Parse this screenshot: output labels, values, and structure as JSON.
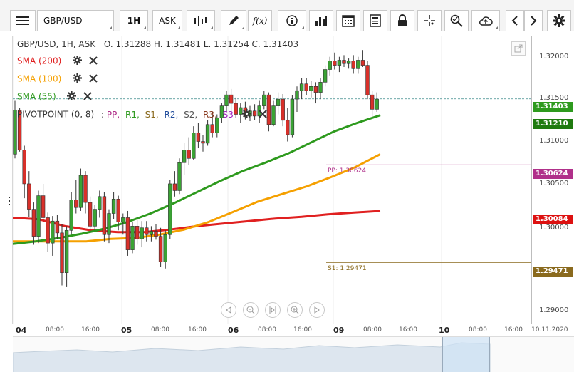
{
  "toolbar": {
    "symbol": "GBP/USD",
    "timeframe": "1H",
    "price_type": "ASK",
    "fx_label": "f(x)"
  },
  "ohlc": {
    "title": "GBP/USD, 1H, ASK",
    "values": "O. 1.31288 H. 1.31481 L. 1.31254 C. 1.31403"
  },
  "indicators": [
    {
      "label": "SMA (200)",
      "color": "#e02020"
    },
    {
      "label": "SMA (100)",
      "color": "#f5a000"
    },
    {
      "label": "SMA (55)",
      "color": "#2e9a1e"
    }
  ],
  "pivot": {
    "label": "PIVOTPOINT (0, 8)",
    "sep": ":",
    "items": [
      {
        "label": "PP,",
        "color": "#b0308a"
      },
      {
        "label": "R1,",
        "color": "#2e9a1e"
      },
      {
        "label": "S1,",
        "color": "#8a6a1e"
      },
      {
        "label": "R2,",
        "color": "#1e4a9a"
      },
      {
        "label": "S2,",
        "color": "#555555"
      },
      {
        "label": "R3,",
        "color": "#8a3a1e"
      },
      {
        "label": "S3",
        "color": "#a020c0"
      }
    ],
    "pp_text": "PP: 1.30624",
    "s1_text": "S1: 1.29471"
  },
  "price_axis": {
    "ticks": [
      "1.32000",
      "1.31500",
      "1.31000",
      "1.30500",
      "1.30000",
      "1.29000"
    ],
    "current": "1.31403",
    "sma55": "1.31210",
    "pp": "1.30624",
    "sma200": "1.30084",
    "s1": "1.29471",
    "colors": {
      "current": "#2e9a1e",
      "sma55": "#1f7a10",
      "pp": "#b0308a",
      "sma200": "#dd1111",
      "s1": "#8a6a1e"
    }
  },
  "time_axis": {
    "labels": [
      {
        "text": "04",
        "bold": true
      },
      {
        "text": "08:00",
        "bold": false
      },
      {
        "text": "16:00",
        "bold": false
      },
      {
        "text": "05",
        "bold": true
      },
      {
        "text": "08:00",
        "bold": false
      },
      {
        "text": "16:00",
        "bold": false
      },
      {
        "text": "06",
        "bold": true
      },
      {
        "text": "08:00",
        "bold": false
      },
      {
        "text": "16:00",
        "bold": false
      },
      {
        "text": "09",
        "bold": true
      },
      {
        "text": "08:00",
        "bold": false
      },
      {
        "text": "16:00",
        "bold": false
      },
      {
        "text": "10",
        "bold": true
      },
      {
        "text": "08:00",
        "bold": false
      },
      {
        "text": "16:00",
        "bold": false
      },
      {
        "text": "10.11.2020",
        "bold": false
      }
    ]
  },
  "candles": [
    {
      "o": 1.3075,
      "h": 1.3138,
      "l": 1.307,
      "c": 1.3127
    },
    {
      "o": 1.3127,
      "h": 1.313,
      "l": 1.3078,
      "c": 1.308
    },
    {
      "o": 1.308,
      "h": 1.3085,
      "l": 1.3023,
      "c": 1.304
    },
    {
      "o": 1.304,
      "h": 1.3055,
      "l": 1.3001,
      "c": 1.301
    },
    {
      "o": 1.301,
      "h": 1.3018,
      "l": 1.2968,
      "c": 1.2978
    },
    {
      "o": 1.2978,
      "h": 1.3032,
      "l": 1.297,
      "c": 1.3026
    },
    {
      "o": 1.3026,
      "h": 1.304,
      "l": 1.2995,
      "c": 1.3
    },
    {
      "o": 1.3,
      "h": 1.3006,
      "l": 1.296,
      "c": 1.297
    },
    {
      "o": 1.297,
      "h": 1.3002,
      "l": 1.2955,
      "c": 1.2996
    },
    {
      "o": 1.2996,
      "h": 1.3003,
      "l": 1.2975,
      "c": 1.2982
    },
    {
      "o": 1.2982,
      "h": 1.2992,
      "l": 1.292,
      "c": 1.2935
    },
    {
      "o": 1.2935,
      "h": 1.299,
      "l": 1.2918,
      "c": 1.2985
    },
    {
      "o": 1.2985,
      "h": 1.303,
      "l": 1.298,
      "c": 1.3021
    },
    {
      "o": 1.3021,
      "h": 1.3045,
      "l": 1.3005,
      "c": 1.3012
    },
    {
      "o": 1.3012,
      "h": 1.3058,
      "l": 1.3008,
      "c": 1.305
    },
    {
      "o": 1.305,
      "h": 1.3055,
      "l": 1.3005,
      "c": 1.3018
    },
    {
      "o": 1.3018,
      "h": 1.3025,
      "l": 1.2982,
      "c": 1.299
    },
    {
      "o": 1.299,
      "h": 1.3015,
      "l": 1.2985,
      "c": 1.301
    },
    {
      "o": 1.301,
      "h": 1.3032,
      "l": 1.3,
      "c": 1.3025
    },
    {
      "o": 1.3025,
      "h": 1.303,
      "l": 1.2972,
      "c": 1.298
    },
    {
      "o": 1.298,
      "h": 1.301,
      "l": 1.297,
      "c": 1.3005
    },
    {
      "o": 1.3005,
      "h": 1.303,
      "l": 1.2998,
      "c": 1.3022
    },
    {
      "o": 1.3022,
      "h": 1.3026,
      "l": 1.2985,
      "c": 1.2995
    },
    {
      "o": 1.2995,
      "h": 1.3005,
      "l": 1.298,
      "c": 1.3
    },
    {
      "o": 1.3,
      "h": 1.3008,
      "l": 1.2955,
      "c": 1.2962
    },
    {
      "o": 1.2962,
      "h": 1.2995,
      "l": 1.2958,
      "c": 1.299
    },
    {
      "o": 1.299,
      "h": 1.3,
      "l": 1.2968,
      "c": 1.2975
    },
    {
      "o": 1.2975,
      "h": 1.2996,
      "l": 1.2965,
      "c": 1.2988
    },
    {
      "o": 1.2988,
      "h": 1.2996,
      "l": 1.2972,
      "c": 1.298
    },
    {
      "o": 1.298,
      "h": 1.299,
      "l": 1.2972,
      "c": 1.2984
    },
    {
      "o": 1.2984,
      "h": 1.2992,
      "l": 1.2974,
      "c": 1.2978
    },
    {
      "o": 1.2978,
      "h": 1.2988,
      "l": 1.2942,
      "c": 1.2948
    },
    {
      "o": 1.2948,
      "h": 1.2985,
      "l": 1.294,
      "c": 1.298
    },
    {
      "o": 1.298,
      "h": 1.3045,
      "l": 1.2975,
      "c": 1.304
    },
    {
      "o": 1.304,
      "h": 1.3055,
      "l": 1.3025,
      "c": 1.3032
    },
    {
      "o": 1.3032,
      "h": 1.307,
      "l": 1.3028,
      "c": 1.3065
    },
    {
      "o": 1.3065,
      "h": 1.3088,
      "l": 1.305,
      "c": 1.308
    },
    {
      "o": 1.308,
      "h": 1.3095,
      "l": 1.3062,
      "c": 1.307
    },
    {
      "o": 1.307,
      "h": 1.3108,
      "l": 1.3068,
      "c": 1.31
    },
    {
      "o": 1.31,
      "h": 1.3112,
      "l": 1.3082,
      "c": 1.309
    },
    {
      "o": 1.309,
      "h": 1.3098,
      "l": 1.3078,
      "c": 1.3088
    },
    {
      "o": 1.3088,
      "h": 1.3115,
      "l": 1.3085,
      "c": 1.311
    },
    {
      "o": 1.311,
      "h": 1.3125,
      "l": 1.3095,
      "c": 1.31
    },
    {
      "o": 1.31,
      "h": 1.3122,
      "l": 1.3095,
      "c": 1.3118
    },
    {
      "o": 1.3118,
      "h": 1.3135,
      "l": 1.3112,
      "c": 1.3132
    },
    {
      "o": 1.3132,
      "h": 1.315,
      "l": 1.3125,
      "c": 1.3145
    },
    {
      "o": 1.3145,
      "h": 1.3152,
      "l": 1.3125,
      "c": 1.3135
    },
    {
      "o": 1.3135,
      "h": 1.3142,
      "l": 1.3118,
      "c": 1.3122
    },
    {
      "o": 1.3122,
      "h": 1.3135,
      "l": 1.3112,
      "c": 1.313
    },
    {
      "o": 1.313,
      "h": 1.3137,
      "l": 1.3116,
      "c": 1.312
    },
    {
      "o": 1.312,
      "h": 1.3132,
      "l": 1.3114,
      "c": 1.3126
    },
    {
      "o": 1.3126,
      "h": 1.3134,
      "l": 1.3115,
      "c": 1.312
    },
    {
      "o": 1.312,
      "h": 1.3138,
      "l": 1.3112,
      "c": 1.3132
    },
    {
      "o": 1.3132,
      "h": 1.315,
      "l": 1.3128,
      "c": 1.3145
    },
    {
      "o": 1.3145,
      "h": 1.3148,
      "l": 1.3102,
      "c": 1.311
    },
    {
      "o": 1.311,
      "h": 1.3138,
      "l": 1.3108,
      "c": 1.3132
    },
    {
      "o": 1.3132,
      "h": 1.3148,
      "l": 1.3122,
      "c": 1.314
    },
    {
      "o": 1.314,
      "h": 1.3146,
      "l": 1.3108,
      "c": 1.3115
    },
    {
      "o": 1.3115,
      "h": 1.313,
      "l": 1.309,
      "c": 1.3098
    },
    {
      "o": 1.3098,
      "h": 1.3145,
      "l": 1.3095,
      "c": 1.314
    },
    {
      "o": 1.314,
      "h": 1.3155,
      "l": 1.3125,
      "c": 1.315
    },
    {
      "o": 1.315,
      "h": 1.3165,
      "l": 1.314,
      "c": 1.3158
    },
    {
      "o": 1.3158,
      "h": 1.3165,
      "l": 1.3145,
      "c": 1.315
    },
    {
      "o": 1.315,
      "h": 1.3162,
      "l": 1.3142,
      "c": 1.3155
    },
    {
      "o": 1.3155,
      "h": 1.316,
      "l": 1.3135,
      "c": 1.3148
    },
    {
      "o": 1.3148,
      "h": 1.3165,
      "l": 1.314,
      "c": 1.316
    },
    {
      "o": 1.316,
      "h": 1.318,
      "l": 1.3155,
      "c": 1.3175
    },
    {
      "o": 1.3175,
      "h": 1.319,
      "l": 1.3168,
      "c": 1.3185
    },
    {
      "o": 1.3185,
      "h": 1.3195,
      "l": 1.3175,
      "c": 1.318
    },
    {
      "o": 1.318,
      "h": 1.319,
      "l": 1.3172,
      "c": 1.3186
    },
    {
      "o": 1.3186,
      "h": 1.3192,
      "l": 1.3178,
      "c": 1.3182
    },
    {
      "o": 1.3182,
      "h": 1.3188,
      "l": 1.3176,
      "c": 1.3185
    },
    {
      "o": 1.3185,
      "h": 1.3192,
      "l": 1.317,
      "c": 1.3176
    },
    {
      "o": 1.3176,
      "h": 1.319,
      "l": 1.317,
      "c": 1.3186
    },
    {
      "o": 1.3186,
      "h": 1.3198,
      "l": 1.3178,
      "c": 1.318
    },
    {
      "o": 1.318,
      "h": 1.3185,
      "l": 1.314,
      "c": 1.3145
    },
    {
      "o": 1.3145,
      "h": 1.315,
      "l": 1.312,
      "c": 1.3128
    },
    {
      "o": 1.3128,
      "h": 1.3148,
      "l": 1.3125,
      "c": 1.314
    }
  ],
  "sma55": [
    1.2969,
    1.2972,
    1.2976,
    1.2981,
    1.2987,
    1.2995,
    1.3005,
    1.3017,
    1.303,
    1.3043,
    1.3055,
    1.3065,
    1.3076,
    1.3089,
    1.3102,
    1.3112,
    1.3121
  ],
  "sma100": [
    1.2972,
    1.2972,
    1.2972,
    1.2972,
    1.2975,
    1.2976,
    1.298,
    1.2986,
    1.2995,
    1.3007,
    1.3019,
    1.3028,
    1.3037,
    1.3048,
    1.306,
    1.3075
  ],
  "sma200": [
    1.3,
    1.2998,
    1.299,
    1.2985,
    1.2983,
    1.2983,
    1.2986,
    1.299,
    1.2993,
    1.2996,
    1.2999,
    1.3001,
    1.3004,
    1.3006,
    1.3008
  ]
}
